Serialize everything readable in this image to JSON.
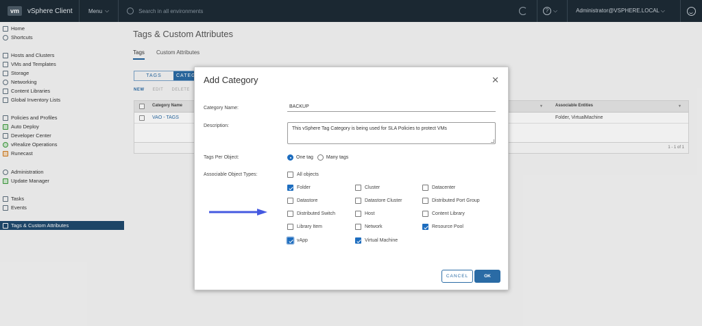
{
  "topbar": {
    "logo": "vm",
    "app_name": "vSphere Client",
    "menu_label": "Menu",
    "search_placeholder": "Search in all environments",
    "user": "Administrator@VSPHERE.LOCAL"
  },
  "sidebar": {
    "items": [
      {
        "label": "Home",
        "icon": "home-icon"
      },
      {
        "label": "Shortcuts",
        "icon": "shortcuts-icon"
      },
      {
        "label": "Hosts and Clusters",
        "icon": "hosts-clusters-icon"
      },
      {
        "label": "VMs and Templates",
        "icon": "vms-templates-icon"
      },
      {
        "label": "Storage",
        "icon": "storage-icon"
      },
      {
        "label": "Networking",
        "icon": "networking-icon"
      },
      {
        "label": "Content Libraries",
        "icon": "content-libraries-icon"
      },
      {
        "label": "Global Inventory Lists",
        "icon": "inventory-lists-icon"
      },
      {
        "label": "Policies and Profiles",
        "icon": "policies-icon"
      },
      {
        "label": "Auto Deploy",
        "icon": "auto-deploy-icon"
      },
      {
        "label": "Developer Center",
        "icon": "developer-center-icon"
      },
      {
        "label": "vRealize Operations",
        "icon": "vrealize-icon"
      },
      {
        "label": "Runecast",
        "icon": "runecast-icon"
      },
      {
        "label": "Administration",
        "icon": "administration-icon"
      },
      {
        "label": "Update Manager",
        "icon": "update-manager-icon"
      },
      {
        "label": "Tasks",
        "icon": "tasks-icon"
      },
      {
        "label": "Events",
        "icon": "events-icon"
      },
      {
        "label": "Tags & Custom Attributes",
        "icon": "tag-icon"
      }
    ]
  },
  "page": {
    "title": "Tags & Custom Attributes",
    "tabs": [
      "Tags",
      "Custom Attributes"
    ],
    "segment": {
      "tags": "TAGS",
      "categories": "CATEG"
    },
    "actions": {
      "new": "NEW",
      "edit": "EDIT",
      "delete": "DELETE"
    },
    "grid": {
      "col_category": "Category Name",
      "col_entities": "Associable Entities",
      "row_name": "VAO - TAGS",
      "row_entities": "Folder, VirtualMachine",
      "footer": "1 - 1 of 1"
    }
  },
  "dialog": {
    "title": "Add Category",
    "name_label": "Category Name:",
    "name_value": "BACKUP",
    "desc_label": "Description:",
    "desc_value": "This vSphere Tag Category is being used for SLA Policies to protect VMs",
    "tags_per_object_label": "Tags Per Object:",
    "one_tag": "One tag",
    "many_tags": "Many tags",
    "object_types_label": "Associable Object Types:",
    "all_objects": "All objects",
    "types": {
      "folder": "Folder",
      "cluster": "Cluster",
      "datacenter": "Datacenter",
      "datastore": "Datastore",
      "datastore_cluster": "Datastore Cluster",
      "distributed_port_group": "Distributed Port Group",
      "distributed_switch": "Distributed Switch",
      "host": "Host",
      "content_library": "Content Library",
      "library_item": "Library Item",
      "network": "Network",
      "resource_pool": "Resource Pool",
      "vapp": "vApp",
      "virtual_machine": "Virtual Machine"
    },
    "cancel": "CANCEL",
    "ok": "OK"
  },
  "colors": {
    "accent": "#2a6ba5",
    "arrow": "#4459e0",
    "header": "#1d2b36"
  }
}
